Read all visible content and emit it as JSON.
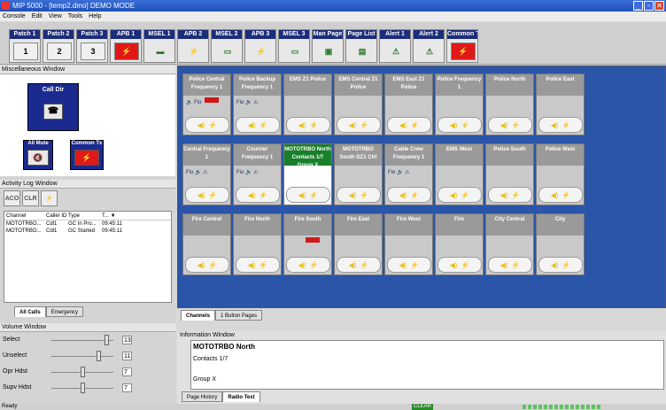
{
  "window": {
    "title": "MIP 5000 - [temp2.dmo] DEMO MODE",
    "controls": [
      "_",
      "▫",
      "✕"
    ]
  },
  "menu": [
    "Console",
    "Edit",
    "View",
    "Tools",
    "Help"
  ],
  "toolbar": [
    {
      "label": "Patch 1",
      "icon": "1",
      "style": "box"
    },
    {
      "label": "Patch 2",
      "icon": "2",
      "style": "box"
    },
    {
      "label": "Patch 3",
      "icon": "3",
      "style": "box"
    },
    {
      "label": "APB 1",
      "icon": "⚡",
      "style": "red"
    },
    {
      "label": "MSEL 1",
      "icon": "▬",
      "style": "flat"
    },
    {
      "label": "APB 2",
      "icon": "⚡",
      "style": "flat"
    },
    {
      "label": "MSEL 2",
      "icon": "▭",
      "style": "flat"
    },
    {
      "label": "APB 3",
      "icon": "⚡",
      "style": "flat"
    },
    {
      "label": "MSEL 3",
      "icon": "▭",
      "style": "flat"
    },
    {
      "label": "Man Page",
      "icon": "▣",
      "style": "flat"
    },
    {
      "label": "Page List",
      "icon": "▤",
      "style": "flat"
    },
    {
      "label": "Alert 1",
      "icon": "⚠",
      "style": "flat"
    },
    {
      "label": "Alert 2",
      "icon": "⚠",
      "style": "flat"
    },
    {
      "label": "Common Tx",
      "icon": "⚡",
      "style": "red"
    }
  ],
  "misc": {
    "header": "Miscellaneous Window",
    "call_dir": "Call Dir",
    "all_mute": "All Mute",
    "common_tx": "Common Tx"
  },
  "activity": {
    "header": "Activity Log Window",
    "tools": [
      "ACO",
      "CLR",
      "⚡"
    ],
    "columns": [
      "Channel",
      "Caller ID",
      "Type",
      "T... ▼"
    ],
    "rows": [
      [
        "MOTOTRBO...",
        "Cdl1",
        "GC In Pro...",
        "09:45:11"
      ],
      [
        "MOTOTRBO...",
        "Cdl1",
        "GC Started",
        "09:45:11"
      ]
    ],
    "tabs": [
      "All Calls",
      "Emergency"
    ]
  },
  "volume": {
    "header": "Volume Window",
    "items": [
      {
        "label": "Select",
        "value": "13",
        "level": 0.92
      },
      {
        "label": "Unselect",
        "value": "11",
        "level": 0.78
      },
      {
        "label": "Opr Hdst",
        "value": "7",
        "level": 0.5
      },
      {
        "label": "Supv Hdst",
        "value": "7",
        "level": 0.5
      }
    ]
  },
  "channels": [
    {
      "name": "Police Central Frequency 1",
      "status": "🔈 Fio",
      "red": true
    },
    {
      "name": "Police Backup Frequency 1",
      "status": "Fio 🔊 ⚠"
    },
    {
      "name": "EMS Z1 Police",
      "status": ""
    },
    {
      "name": "EMS Central Z1 Police",
      "status": ""
    },
    {
      "name": "EMS East Z1 Police",
      "status": ""
    },
    {
      "name": "Police Frequency 1",
      "status": ""
    },
    {
      "name": "Police North",
      "status": ""
    },
    {
      "name": "Police East",
      "status": ""
    },
    {
      "name": "Central Frequency 1",
      "status": "Fio 🔊 ⚠"
    },
    {
      "name": "Courrier Frequency 1",
      "status": "Fio 🔊 ⚠"
    },
    {
      "name": "MOTOTRBO North Contacts 1/7 Group X",
      "status": "",
      "selected": true
    },
    {
      "name": "MOTOTRBO South DZ1 Cht",
      "status": ""
    },
    {
      "name": "Cable Crew Frequency 1",
      "status": "Fio 🔊 ⚠"
    },
    {
      "name": "EMS West",
      "status": ""
    },
    {
      "name": "Police South",
      "status": ""
    },
    {
      "name": "Police West",
      "status": ""
    },
    {
      "name": "Fire Central",
      "status": ""
    },
    {
      "name": "Fire North",
      "status": ""
    },
    {
      "name": "Fire South",
      "status": "",
      "red": true
    },
    {
      "name": "Fire East",
      "status": ""
    },
    {
      "name": "Fire West",
      "status": ""
    },
    {
      "name": "Fire",
      "status": ""
    },
    {
      "name": "City Central",
      "status": ""
    },
    {
      "name": "City",
      "status": ""
    }
  ],
  "channel_tabs": [
    "Channels",
    "1 Button Pages"
  ],
  "info": {
    "header": "Information Window",
    "title": "MOTOTRBO North",
    "line1": "Contacts 1/7",
    "line2": "Group X",
    "tabs": [
      "Page History",
      "Radio Text"
    ]
  },
  "status": {
    "left": "Ready",
    "clear": "CLEAR"
  }
}
